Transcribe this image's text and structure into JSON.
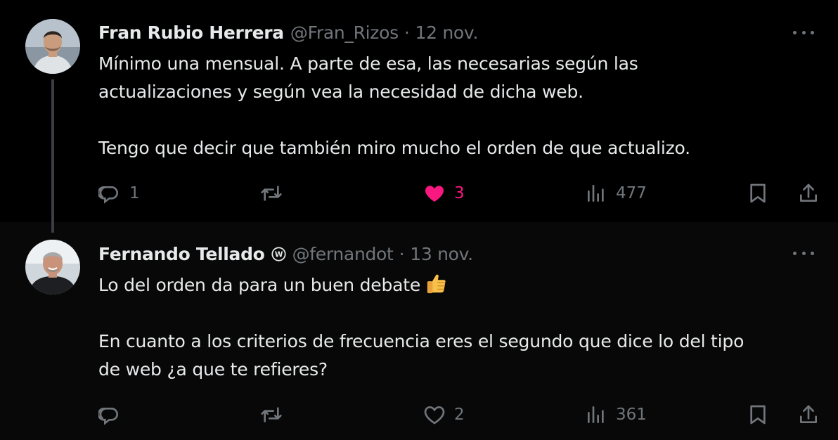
{
  "tweets": [
    {
      "name": "Fran Rubio Herrera",
      "handle": "@Fran_Rizos",
      "separator": "·",
      "date": "12 nov.",
      "lines": [
        "Mínimo una mensual. A parte de esa, las necesarias según las",
        "actualizaciones y según vea la necesidad de dicha web.",
        "",
        "Tengo que decir que también miro mucho el orden de que actualizo."
      ],
      "actions": {
        "reply_count": "1",
        "retweet_count": "",
        "like_count": "3",
        "liked": true,
        "view_count": "477"
      }
    },
    {
      "name": "Fernando Tellado",
      "handle": "@fernandot",
      "separator": "·",
      "date": "13 nov.",
      "lines": [
        "Lo del orden da para un buen debate",
        "",
        "En cuanto a los criterios de frecuencia eres el segundo que dice lo del tipo",
        "de web ¿a que te refieres?"
      ],
      "emoji": "thumbs-up",
      "actions": {
        "reply_count": "",
        "retweet_count": "",
        "like_count": "2",
        "liked": false,
        "view_count": "361"
      }
    }
  ],
  "colors": {
    "text": "#e7e9ea",
    "muted": "#71767b",
    "like": "#f91880",
    "background": "#000000"
  },
  "icons": [
    "reply-icon",
    "retweet-icon",
    "like-icon",
    "views-icon",
    "bookmark-icon",
    "share-icon",
    "more-icon",
    "wordpress-badge-icon"
  ]
}
